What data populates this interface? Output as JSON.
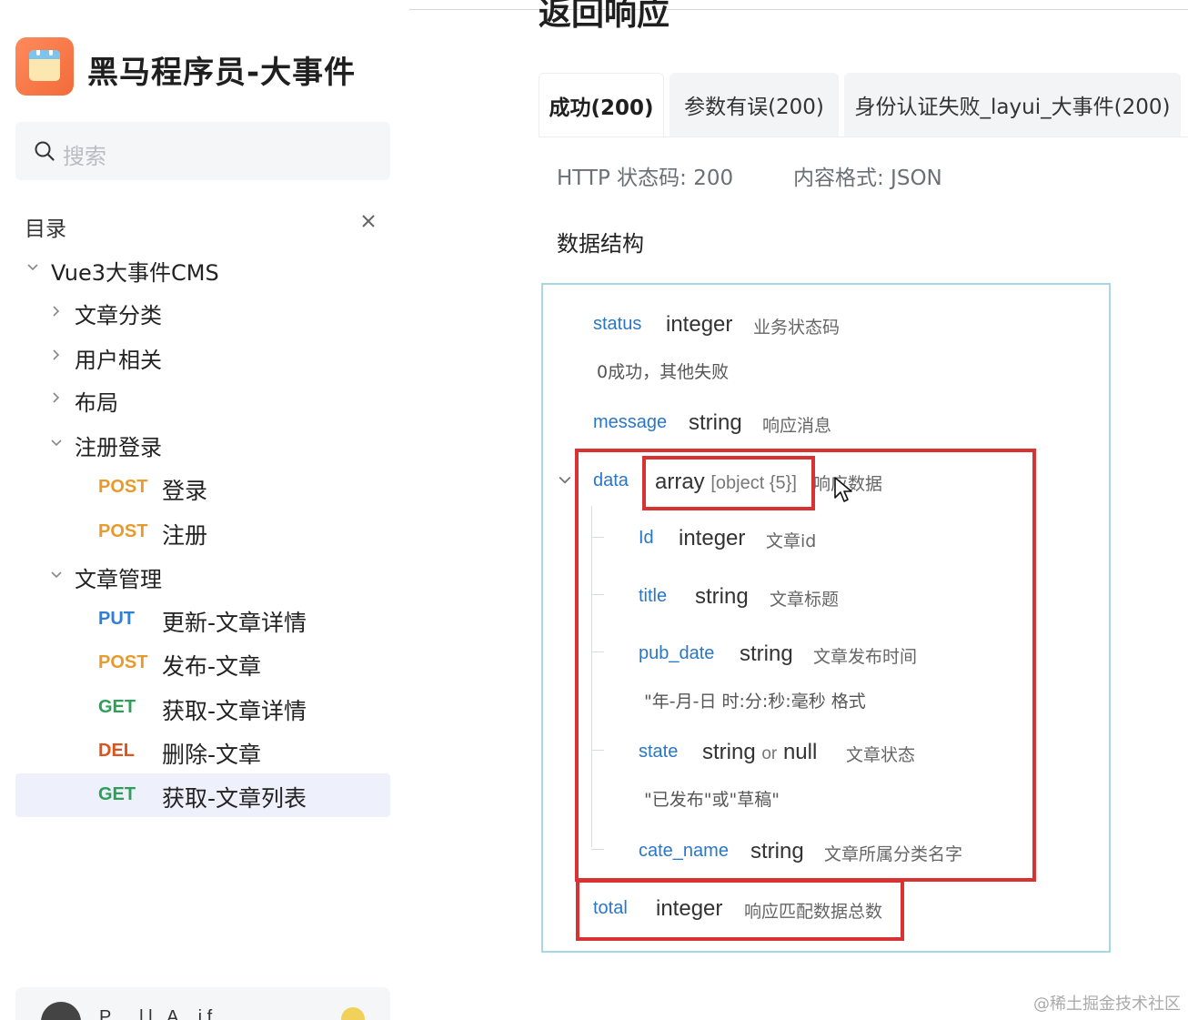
{
  "app": {
    "title": "黑马程序员-大事件"
  },
  "search": {
    "placeholder": "搜索"
  },
  "toc": {
    "heading": "目录",
    "root": "Vue3大事件CMS",
    "groups": [
      {
        "label": "文章分类",
        "expanded": false
      },
      {
        "label": "用户相关",
        "expanded": false
      },
      {
        "label": "布局",
        "expanded": false
      },
      {
        "label": "注册登录",
        "expanded": true
      },
      {
        "label": "文章管理",
        "expanded": true
      }
    ],
    "apis_register": [
      {
        "method": "POST",
        "name": "登录"
      },
      {
        "method": "POST",
        "name": "注册"
      }
    ],
    "apis_article": [
      {
        "method": "PUT",
        "name": "更新-文章详情"
      },
      {
        "method": "POST",
        "name": "发布-文章"
      },
      {
        "method": "GET",
        "name": "获取-文章详情"
      },
      {
        "method": "DEL",
        "name": "删除-文章"
      },
      {
        "method": "GET",
        "name": "获取-文章列表",
        "active": true
      }
    ]
  },
  "bottom": {
    "text": "P..... l l . A .. i f"
  },
  "main": {
    "heading": "返回响应",
    "tabs": [
      {
        "label": "成功(200)",
        "active": true
      },
      {
        "label": "参数有误(200)"
      },
      {
        "label": "身份认证失败_layui_大事件(200)"
      }
    ],
    "http_status": "HTTP 状态码: 200",
    "content_type": "内容格式: JSON",
    "section_title": "数据结构",
    "schema": {
      "status": {
        "name": "status",
        "type": "integer",
        "desc": "业务状态码",
        "note": "0成功，其他失败"
      },
      "message": {
        "name": "message",
        "type": "string",
        "desc": "响应消息"
      },
      "data": {
        "name": "data",
        "type": "array",
        "sub": "[object {5}]",
        "desc": "响应数据"
      },
      "id": {
        "name": "Id",
        "type": "integer",
        "desc": "文章id"
      },
      "title": {
        "name": "title",
        "type": "string",
        "desc": "文章标题"
      },
      "pub_date": {
        "name": "pub_date",
        "type": "string",
        "desc": "文章发布时间",
        "note": "\"年-月-日 时:分:秒:毫秒 格式"
      },
      "state": {
        "name": "state",
        "type": "string",
        "or": "or",
        "type2": "null",
        "desc": "文章状态",
        "note": "\"已发布\"或\"草稿\""
      },
      "cate_name": {
        "name": "cate_name",
        "type": "string",
        "desc": "文章所属分类名字"
      },
      "total": {
        "name": "total",
        "type": "integer",
        "desc": "响应匹配数据总数"
      }
    }
  },
  "watermark": "@稀土掘金技术社区",
  "colors": {
    "post": "#e89a2c",
    "put": "#2f7fd6",
    "get": "#2f9e5b",
    "del": "#d9541e",
    "field": "#2a76c9",
    "highlight_box": "#d93232",
    "schema_border": "#a7d7e6"
  }
}
